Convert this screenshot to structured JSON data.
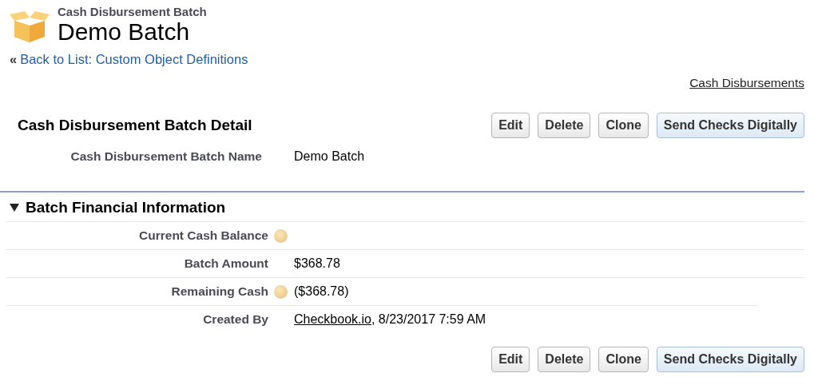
{
  "header": {
    "object_type": "Cash Disbursement Batch",
    "title": "Demo Batch",
    "back_link": {
      "prefix": "«",
      "label": "Back to List: Custom Object Definitions"
    }
  },
  "related_link": "Cash Disbursements",
  "detail": {
    "title": "Cash Disbursement Batch Detail",
    "top_buttons": [
      {
        "label": "Edit",
        "highlighted": false
      },
      {
        "label": "Delete",
        "highlighted": false
      },
      {
        "label": "Clone",
        "highlighted": false
      },
      {
        "label": "Send Checks Digitally",
        "highlighted": true
      }
    ],
    "name_field": {
      "label": "Cash Disbursement Batch Name",
      "value": "Demo Batch"
    },
    "section": {
      "title": "Batch Financial Information",
      "expanded": true,
      "fields": [
        {
          "label": "Current Cash Balance",
          "help": true
        },
        {
          "label": "Batch Amount",
          "help": false,
          "value": "$368.78"
        },
        {
          "label": "Remaining Cash",
          "help": true,
          "value": "($368.78)"
        },
        {
          "label": "Created By",
          "help": false,
          "link": "Checkbook.io",
          "value": ", 8/23/2017 7:59 AM"
        }
      ]
    },
    "bottom_buttons": [
      {
        "label": "Edit",
        "highlighted": false
      },
      {
        "label": "Delete",
        "highlighted": false
      },
      {
        "label": "Clone",
        "highlighted": false
      },
      {
        "label": "Send Checks Digitally",
        "highlighted": true
      }
    ]
  }
}
